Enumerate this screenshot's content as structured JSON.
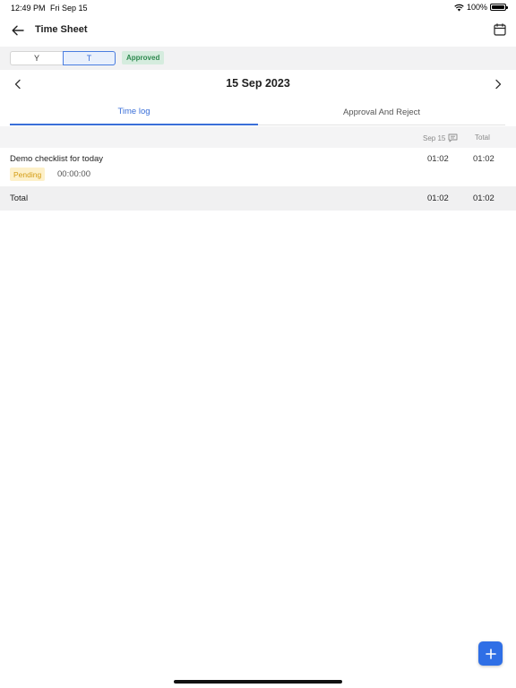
{
  "status_bar": {
    "time": "12:49 PM",
    "date": "Fri Sep 15",
    "battery": "100%"
  },
  "header": {
    "title": "Time Sheet"
  },
  "filter": {
    "options": [
      "Y",
      "T"
    ],
    "selected": "T",
    "status_badge": "Approved"
  },
  "date_nav": {
    "date": "15 Sep 2023"
  },
  "tabs": [
    {
      "label": "Time log",
      "active": true
    },
    {
      "label": "Approval And Reject",
      "active": false
    }
  ],
  "table": {
    "date_column": "Sep 15",
    "total_column": "Total",
    "entries": [
      {
        "title": "Demo checklist for today",
        "status": "Pending",
        "duration": "00:00:00",
        "hours": "01:02",
        "total": "01:02"
      }
    ],
    "total_row": {
      "label": "Total",
      "hours": "01:02",
      "total": "01:02"
    }
  },
  "colors": {
    "accent": "#3a6fd8",
    "fab": "#2f6fe6",
    "approved_bg": "#d5ecde",
    "pending_bg": "#fdf0c9"
  }
}
